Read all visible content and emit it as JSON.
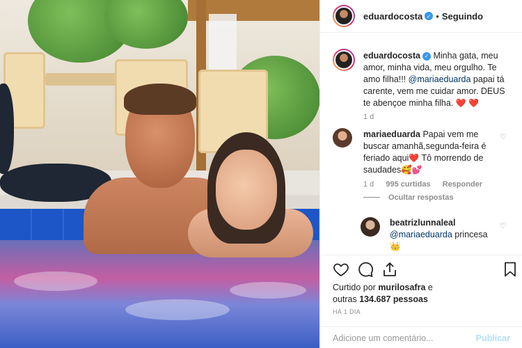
{
  "post": {
    "author": "eduardocosta",
    "follow_status": "Seguindo",
    "separator": "•",
    "caption": "Minha gata, meu amor, minha vida, meu orgulho. Te amo filha!!! ",
    "caption_mention": "@mariaeduarda",
    "caption_rest": " papai tá carente, vem me cuidar amor. DEUS te abençoe minha filha. ",
    "caption_time": "1 d"
  },
  "comments": [
    {
      "user": "mariaeduarda",
      "text_1": "Papai vem me buscar amanhã,segunda-feira é feriado aqui",
      "text_2": " Tô morrendo de saudades",
      "time": "1 d",
      "likes": "995 curtidas",
      "reply": "Responder",
      "hide_replies": "Ocultar respostas"
    },
    {
      "user": "beatrizlunnaleal",
      "mention": "@mariaeduarda",
      "text": " princesa",
      "emoji": "👑"
    }
  ],
  "likes": {
    "prefix": "Curtido por ",
    "user": "murilosafra",
    "middle": " e",
    "line2_prefix": "outras ",
    "count": "134.687 pessoas"
  },
  "timestamp": "HÁ 1 DIA",
  "comment_box": {
    "placeholder": "Adicione um comentário...",
    "publish": "Publicar"
  },
  "colors": {
    "verified": "#3897f0",
    "mention": "#003569",
    "heart": "#e2262f",
    "publish_disabled": "#b2dffc"
  },
  "icons": [
    "verified-badge-icon",
    "heart-outline-icon",
    "comment-icon",
    "share-icon",
    "bookmark-icon",
    "heart-emoji-icon",
    "crown-emoji-icon"
  ]
}
